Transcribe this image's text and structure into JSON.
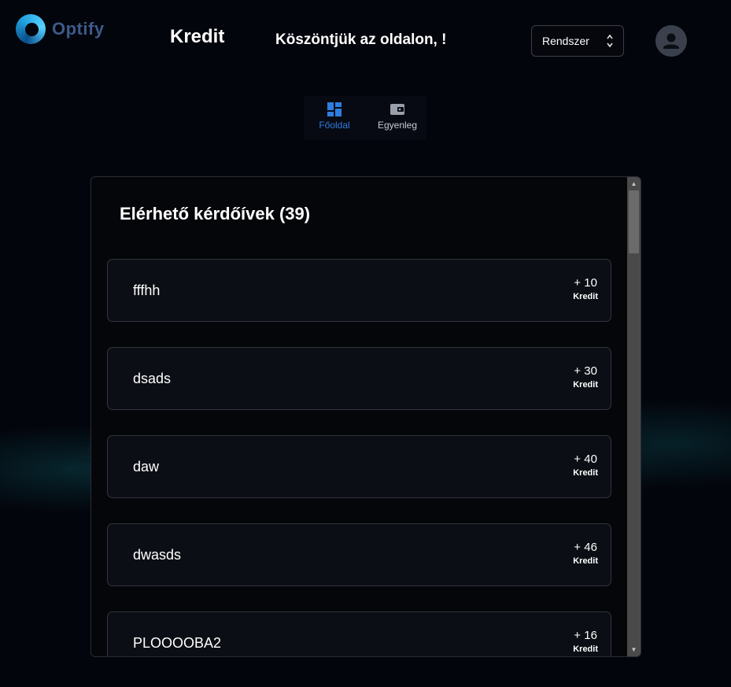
{
  "brand": {
    "name": "Optify"
  },
  "header": {
    "title": "Kredit",
    "welcome": "Köszöntjük az oldalon, !",
    "system_select": {
      "value": "Rendszer"
    }
  },
  "nav": {
    "items": [
      {
        "label": "Főoldal",
        "icon": "dashboard-icon",
        "active": true
      },
      {
        "label": "Egyenleg",
        "icon": "wallet-icon",
        "active": false
      }
    ]
  },
  "panel": {
    "title": "Elérhető kérdőívek (39)",
    "surveys": [
      {
        "name": "fffhh",
        "amount": "+ 10",
        "unit": "Kredit"
      },
      {
        "name": "dsads",
        "amount": "+ 30",
        "unit": "Kredit"
      },
      {
        "name": "daw",
        "amount": "+ 40",
        "unit": "Kredit"
      },
      {
        "name": "dwasds",
        "amount": "+ 46",
        "unit": "Kredit"
      },
      {
        "name": "PLOOOOBA2",
        "amount": "+ 16",
        "unit": "Kredit"
      }
    ]
  },
  "colors": {
    "background": "#03050c",
    "accent": "#2f7de1",
    "card": "#0b0e14",
    "border": "#30343c"
  }
}
